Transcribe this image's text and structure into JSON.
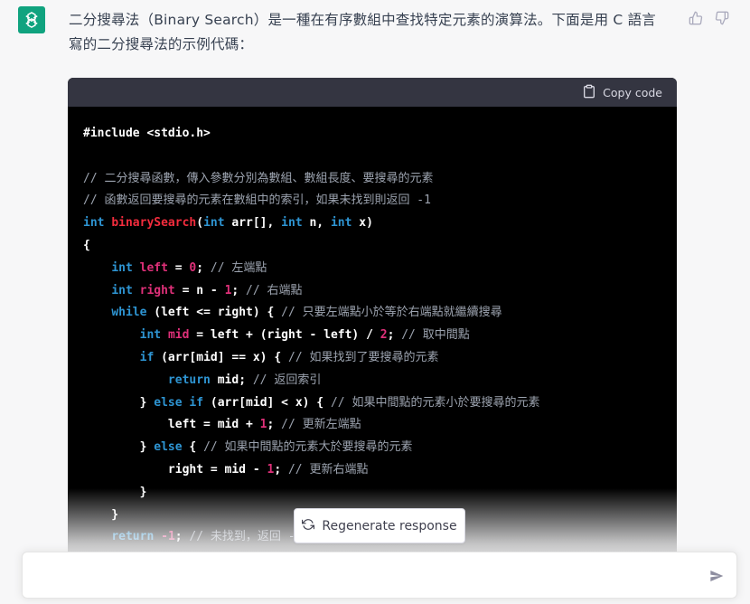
{
  "message": {
    "intro_line1": "二分搜尋法（Binary Search）是一種在有序數組中查找特定元素的演算法。下面是用 C 語言",
    "intro_line2": "寫的二分搜尋法的示例代碼："
  },
  "code_block": {
    "copy_label": "Copy code",
    "lines": [
      "#include <stdio.h>",
      "",
      "// 二分搜尋函數，傳入參數分別為數組、數組長度、要搜尋的元素",
      "// 函數返回要搜尋的元素在數組中的索引，如果未找到則返回 -1",
      "int binarySearch(int arr[], int n, int x)",
      "{",
      "    int left = 0; // 左端點",
      "    int right = n - 1; // 右端點",
      "    while (left <= right) { // 只要左端點小於等於右端點就繼續搜尋",
      "        int mid = left + (right - left) / 2; // 取中間點",
      "        if (arr[mid] == x) { // 如果找到了要搜尋的元素",
      "            return mid; // 返回索引",
      "        } else if (arr[mid] < x) { // 如果中間點的元素小於要搜尋的元素",
      "            left = mid + 1; // 更新左端點",
      "        } else { // 如果中間點的元素大於要搜尋的元素",
      "            right = mid - 1; // 更新右端點",
      "        }",
      "    }",
      "    return -1; // 未找到，返回 -1"
    ]
  },
  "regenerate": {
    "label": "Regenerate response"
  },
  "composer": {
    "placeholder": ""
  },
  "icons": {
    "avatar": "openai-logo-icon",
    "thumbs_up": "thumbs-up-icon",
    "thumbs_down": "thumbs-down-icon",
    "clipboard": "clipboard-icon",
    "refresh": "refresh-icon",
    "send": "send-icon"
  },
  "colors": {
    "avatar_bg": "#10a37f",
    "code_bg": "#000000",
    "code_header_bg": "#343541",
    "keyword": "#2e95d3",
    "function": "#f22c3d",
    "variable": "#df3079",
    "comment": "#9ca3af"
  }
}
